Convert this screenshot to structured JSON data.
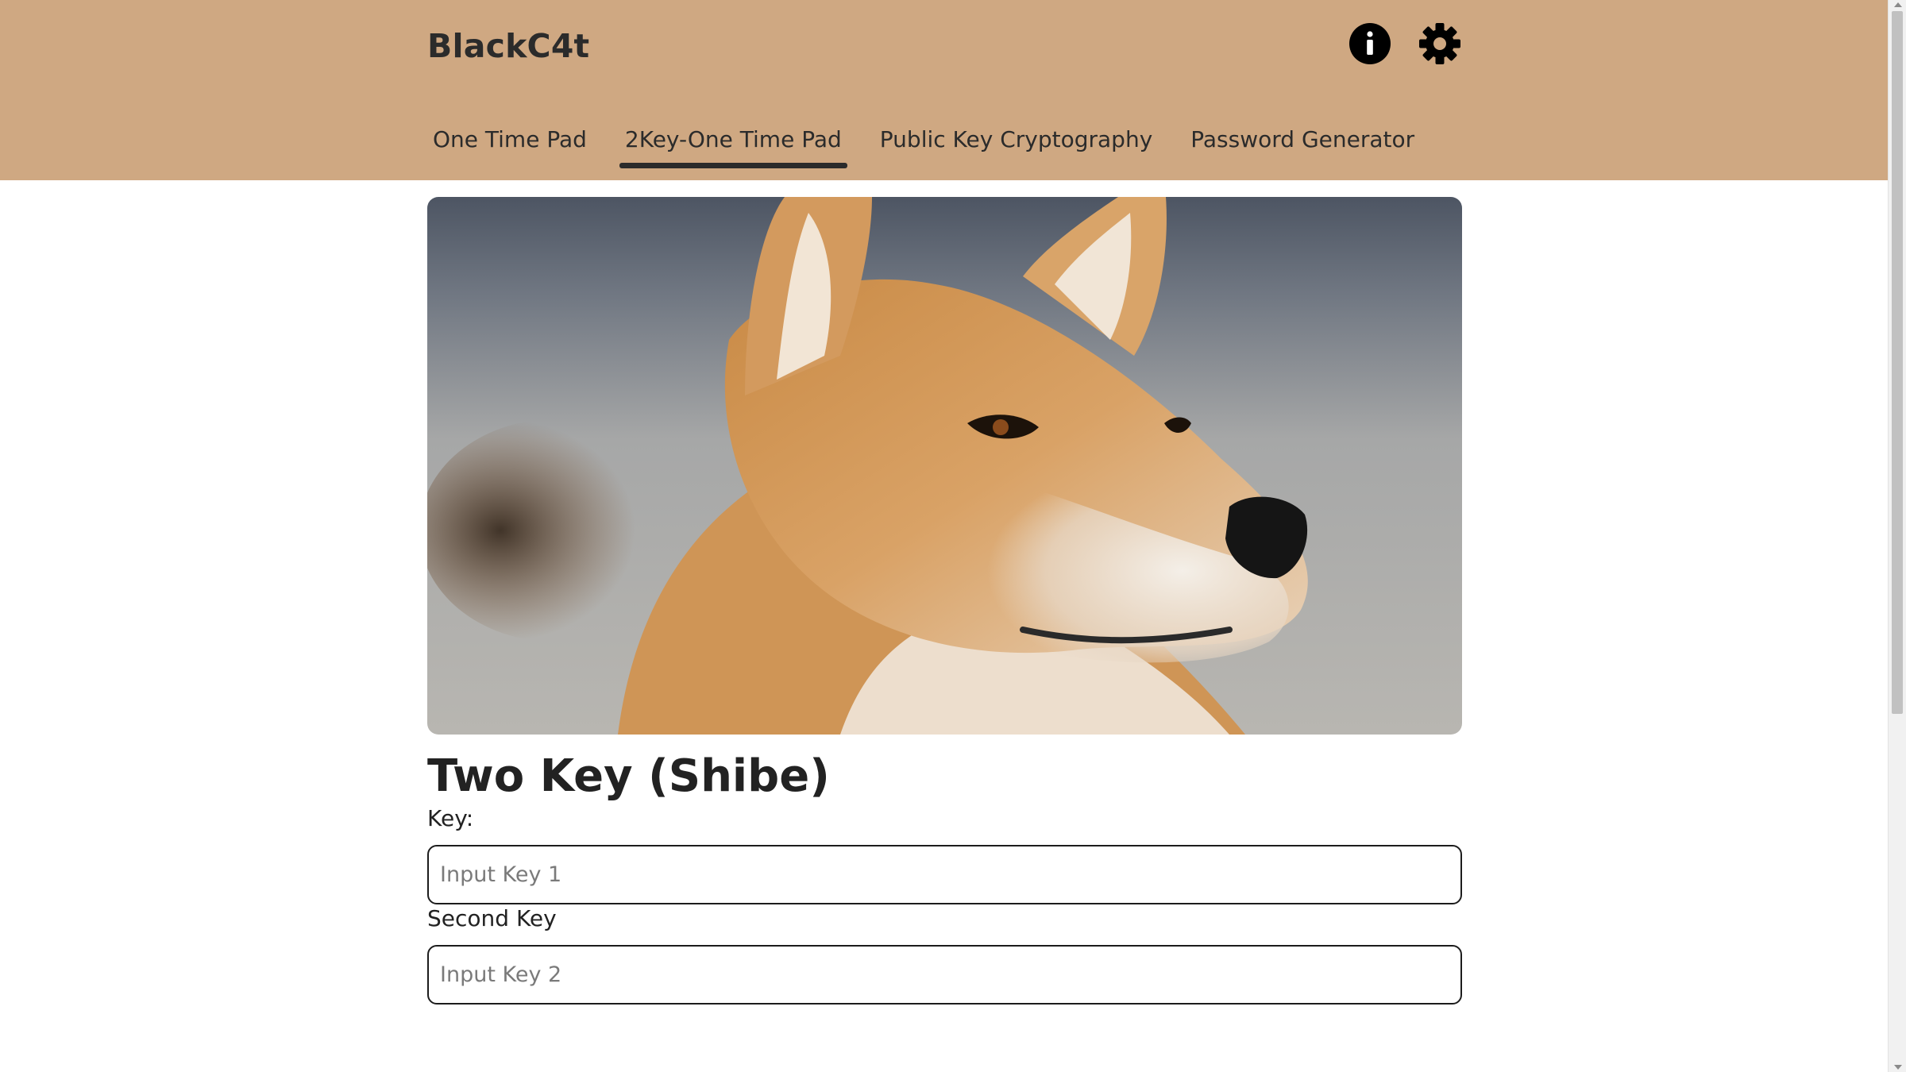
{
  "app": {
    "title": "BlackC4t"
  },
  "header": {
    "icons": [
      {
        "name": "info-icon"
      },
      {
        "name": "gear-icon"
      }
    ]
  },
  "tabs": [
    {
      "label": "One Time Pad",
      "active": false
    },
    {
      "label": "2Key-One Time Pad",
      "active": true
    },
    {
      "label": "Public Key Cryptography",
      "active": false
    },
    {
      "label": "Password Generator",
      "active": false
    }
  ],
  "main": {
    "hero_image": "shiba-inu-dog-photo",
    "title": "Two Key (Shibe)",
    "fields": {
      "key": {
        "label": "Key:",
        "placeholder": "Input Key 1",
        "value": ""
      },
      "second_key": {
        "label": "Second Key",
        "placeholder": "Input Key 2",
        "value": ""
      }
    }
  },
  "colors": {
    "header_bg": "#cfa882",
    "text": "#222222",
    "active_tab_underline": "#2b2b2b"
  }
}
